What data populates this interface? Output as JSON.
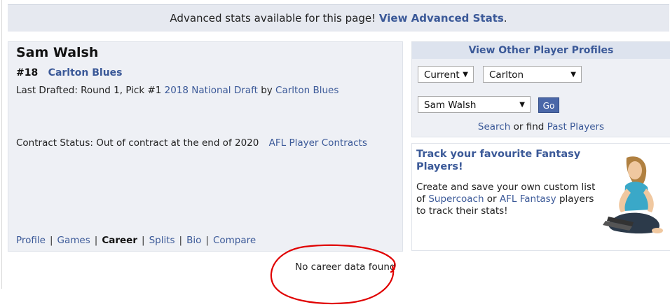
{
  "banner": {
    "text": "Advanced stats available for this page!",
    "link": "View Advanced Stats",
    "suffix": "."
  },
  "player": {
    "name": "Sam Walsh",
    "number": "#18",
    "team": "Carlton Blues",
    "drafted_prefix": "Last Drafted: Round 1, Pick #1",
    "drafted_link": "2018 National Draft",
    "drafted_by": "by",
    "drafted_team": "Carlton Blues",
    "contract_text": "Contract Status: Out of contract at the end of 2020",
    "contract_link": "AFL Player Contracts"
  },
  "tabs": {
    "items": [
      "Profile",
      "Games",
      "Career",
      "Splits",
      "Bio",
      "Compare"
    ],
    "active": "Career",
    "separator": "|"
  },
  "career": {
    "empty_text": "No career data found"
  },
  "other_profiles": {
    "title": "View Other Player Profiles",
    "era_select": "Current",
    "team_select": "Carlton",
    "player_select": "Sam Walsh",
    "go_label": "Go",
    "search_label": "Search",
    "or_find": "or find",
    "past_players": "Past Players"
  },
  "fantasy": {
    "title": "Track your favourite Fantasy Players!",
    "body_1": "Create and save your own custom list of",
    "link_1": "Supercoach",
    "or": "or",
    "link_2": "AFL Fantasy",
    "body_2": "players to track their stats!"
  },
  "colors": {
    "link": "#3b5998",
    "annotation": "#e00000",
    "panel": "#eef0f5"
  }
}
